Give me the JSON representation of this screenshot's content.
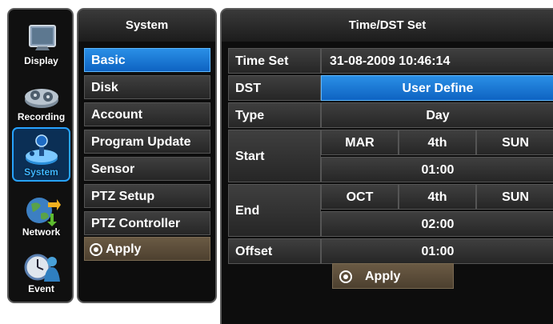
{
  "rail": {
    "items": [
      {
        "label": "Display",
        "icon": "monitor-icon"
      },
      {
        "label": "Recording",
        "icon": "reels-icon"
      },
      {
        "label": "System",
        "icon": "joystick-icon",
        "active": true
      },
      {
        "label": "Network",
        "icon": "globe-icon"
      },
      {
        "label": "Event",
        "icon": "clock-person-icon"
      }
    ]
  },
  "menu": {
    "title": "System",
    "items": [
      "Basic",
      "Disk",
      "Account",
      "Program Update",
      "Sensor",
      "PTZ Setup",
      "PTZ Controller"
    ],
    "selected": "Basic",
    "apply_label": "Apply"
  },
  "panel": {
    "title": "Time/DST Set",
    "time_set": {
      "label": "Time Set",
      "value": "31-08-2009 10:46:14"
    },
    "dst": {
      "label": "DST",
      "value": "User Define"
    },
    "type": {
      "label": "Type",
      "value": "Day"
    },
    "start": {
      "label": "Start",
      "month": "MAR",
      "week": "4th",
      "day": "SUN",
      "time": "01:00"
    },
    "end": {
      "label": "End",
      "month": "OCT",
      "week": "4th",
      "day": "SUN",
      "time": "02:00"
    },
    "offset": {
      "label": "Offset",
      "value": "01:00"
    },
    "apply_label": "Apply"
  },
  "colors": {
    "selected": "#1a7ad6",
    "apply": "#5b4c38",
    "background": "#0d0d0d"
  }
}
